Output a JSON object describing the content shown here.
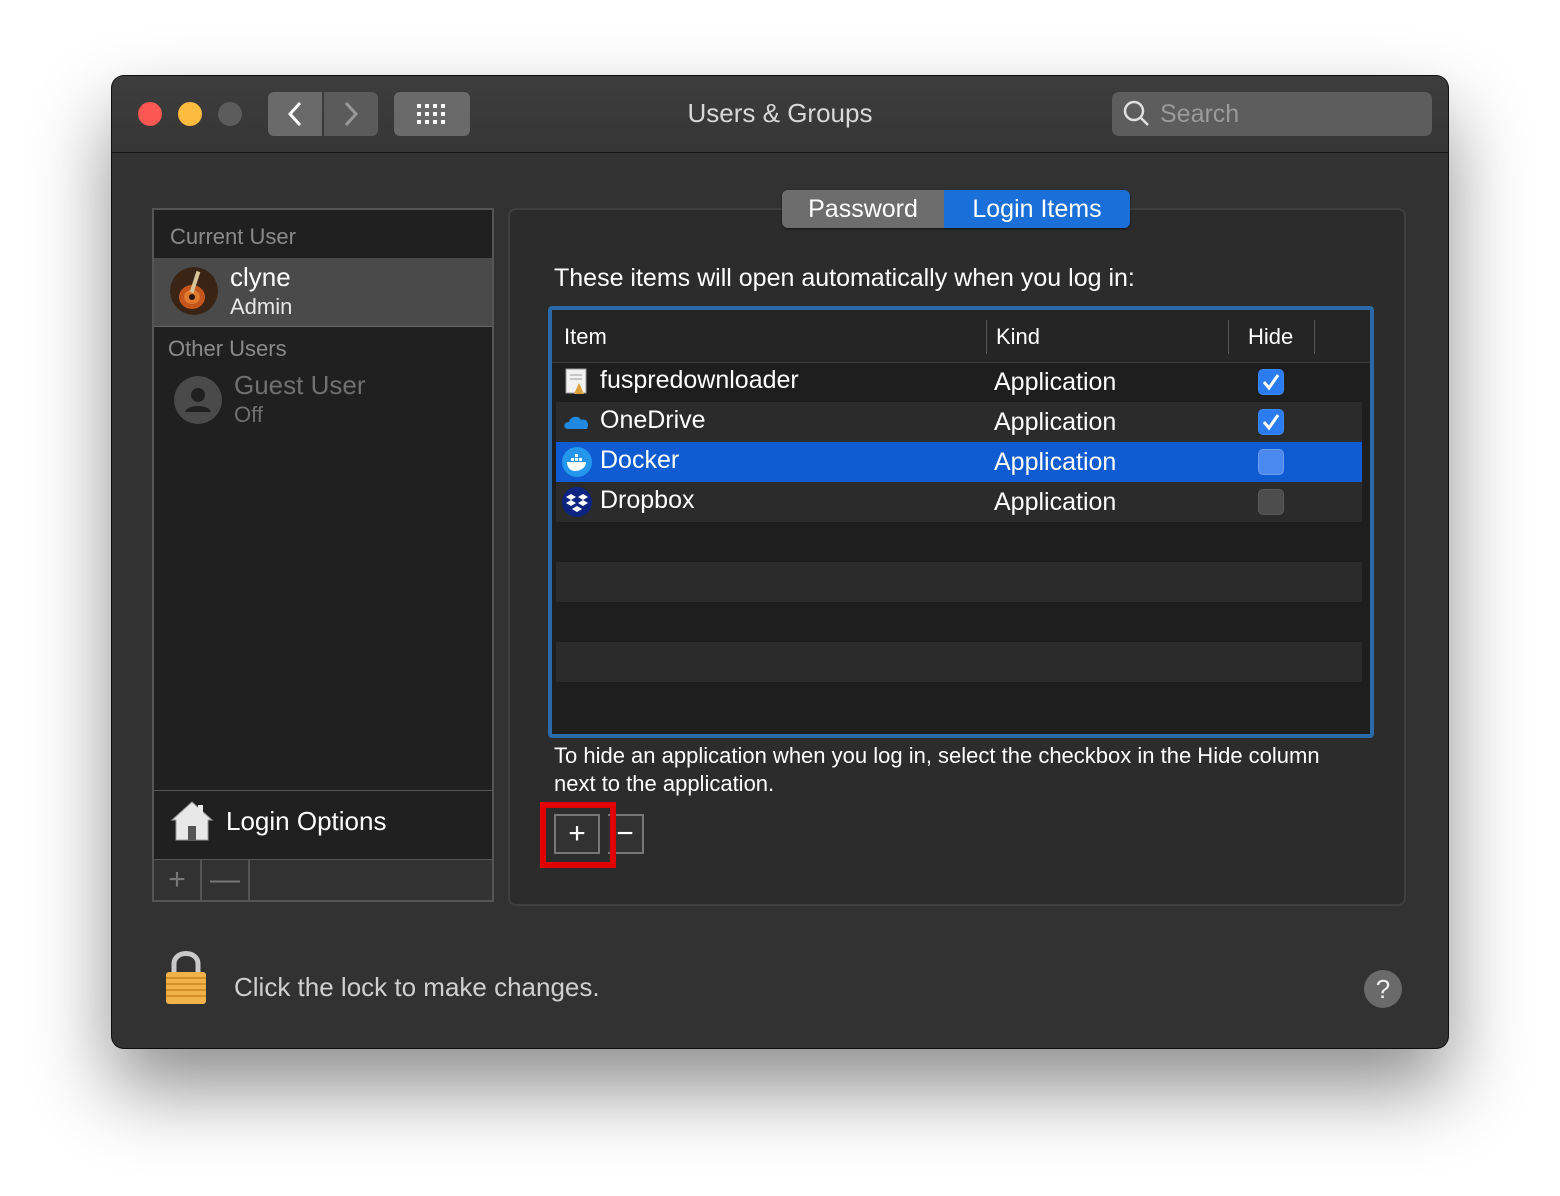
{
  "window": {
    "title": "Users & Groups",
    "search_placeholder": "Search"
  },
  "sidebar": {
    "current_user_header": "Current User",
    "current_user": {
      "name": "clyne",
      "role": "Admin"
    },
    "other_users_header": "Other Users",
    "other_users": [
      {
        "name": "Guest User",
        "status": "Off"
      }
    ],
    "login_options_label": "Login Options",
    "add_symbol": "+",
    "remove_symbol": "—"
  },
  "tabs": [
    {
      "label": "Password",
      "selected": false
    },
    {
      "label": "Login Items",
      "selected": true
    }
  ],
  "login_items": {
    "intro": "These items will open automatically when you log in:",
    "columns": {
      "item": "Item",
      "kind": "Kind",
      "hide": "Hide"
    },
    "rows": [
      {
        "name": "fuspredownloader",
        "kind": "Application",
        "hide": true,
        "icon": "script-app-icon"
      },
      {
        "name": "OneDrive",
        "kind": "Application",
        "hide": true,
        "icon": "cloud-icon"
      },
      {
        "name": "Docker",
        "kind": "Application",
        "hide": false,
        "icon": "docker-whale-icon"
      },
      {
        "name": "Dropbox",
        "kind": "Application",
        "hide": false,
        "icon": "dropbox-icon"
      }
    ],
    "selected_row": "Docker",
    "hint": "To hide an application when you log in, select the checkbox in the Hide column next to the application.",
    "add_symbol": "+",
    "remove_symbol": "−"
  },
  "footer": {
    "lock_text": "Click the lock to make changes.",
    "help_symbol": "?"
  },
  "colors": {
    "accent": "#1a6fd8",
    "selection": "#0f5bd1",
    "highlight_box": "#e00000"
  }
}
